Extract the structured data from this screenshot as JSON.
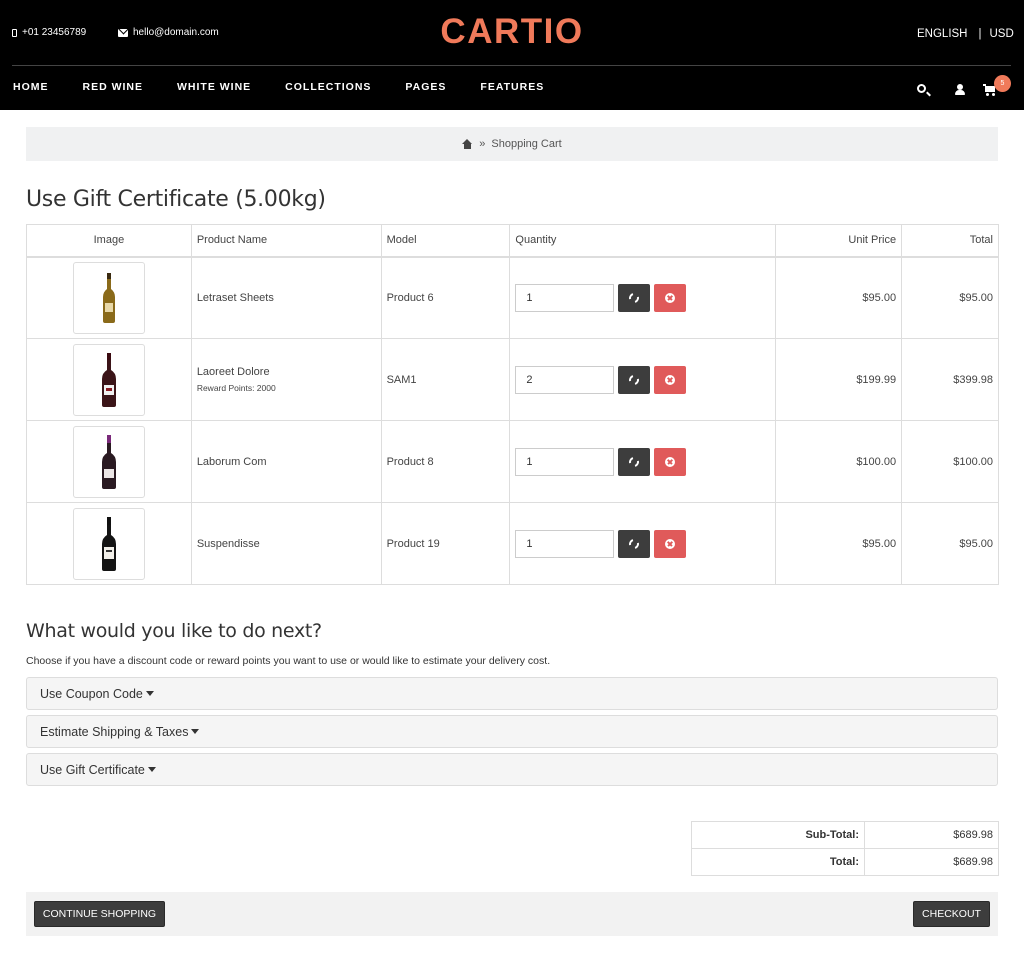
{
  "header": {
    "phone": "+01 23456789",
    "email": "hello@domain.com",
    "logo": "CARTIO",
    "language": "ENGLISH",
    "currency": "USD",
    "cart_count": "5",
    "nav": [
      "HOME",
      "RED WINE",
      "WHITE WINE",
      "COLLECTIONS",
      "PAGES",
      "FEATURES"
    ]
  },
  "breadcrumb": {
    "separator": "»",
    "current": "Shopping Cart"
  },
  "page_title": "Use Gift Certificate  (5.00kg)",
  "cart": {
    "headers": {
      "image": "Image",
      "name": "Product Name",
      "model": "Model",
      "quantity": "Quantity",
      "unit_price": "Unit Price",
      "total": "Total"
    },
    "items": [
      {
        "name": "Letraset Sheets",
        "reward": "",
        "model": "Product 6",
        "qty": "1",
        "unit_price": "$95.00",
        "total": "$95.00",
        "bottle": "white"
      },
      {
        "name": "Laoreet Dolore",
        "reward": "Reward Points: 2000",
        "model": "SAM1",
        "qty": "2",
        "unit_price": "$199.99",
        "total": "$399.98",
        "bottle": "red"
      },
      {
        "name": "Laborum Com",
        "reward": "",
        "model": "Product 8",
        "qty": "1",
        "unit_price": "$100.00",
        "total": "$100.00",
        "bottle": "purple"
      },
      {
        "name": "Suspendisse",
        "reward": "",
        "model": "Product 19",
        "qty": "1",
        "unit_price": "$95.00",
        "total": "$95.00",
        "bottle": "dark"
      }
    ]
  },
  "next": {
    "heading": "What would you like to do next?",
    "description": "Choose if you have a discount code or reward points you want to use or would like to estimate your delivery cost.",
    "options": [
      "Use Coupon Code",
      "Estimate Shipping & Taxes",
      "Use Gift Certificate"
    ]
  },
  "totals": [
    {
      "label": "Sub-Total:",
      "value": "$689.98"
    },
    {
      "label": "Total:",
      "value": "$689.98"
    }
  ],
  "buttons": {
    "continue": "CONTINUE SHOPPING",
    "checkout": "CHECKOUT"
  },
  "colors": {
    "accent": "#f07a5a",
    "header_bg": "#000000",
    "remove": "#e05a5a",
    "dark_button": "#3d3d3d"
  }
}
